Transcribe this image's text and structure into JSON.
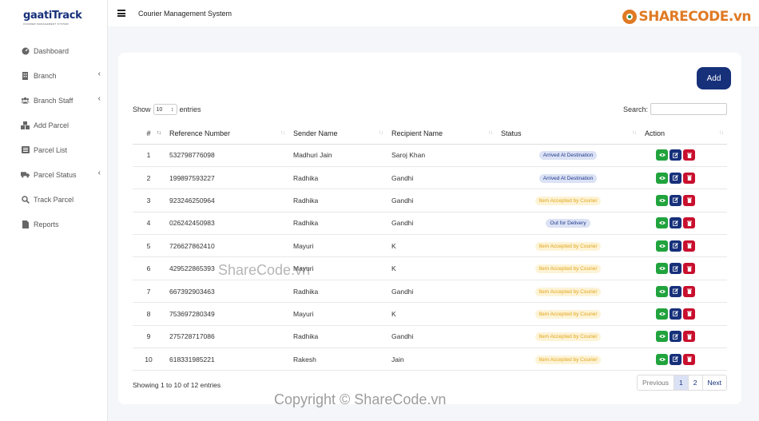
{
  "brand": {
    "name": "gaatiTrack",
    "tagline": "COURIER MANAGEMENT SYSTEM"
  },
  "app_title": "Courier Management System",
  "sidebar": {
    "items": [
      {
        "label": "Dashboard",
        "icon": "dashboard-icon",
        "submenu": false
      },
      {
        "label": "Branch",
        "icon": "building-icon",
        "submenu": true
      },
      {
        "label": "Branch Staff",
        "icon": "users-icon",
        "submenu": true
      },
      {
        "label": "Add Parcel",
        "icon": "boxes-icon",
        "submenu": false
      },
      {
        "label": "Parcel List",
        "icon": "list-icon",
        "submenu": false
      },
      {
        "label": "Parcel Status",
        "icon": "truck-icon",
        "submenu": true
      },
      {
        "label": "Track Parcel",
        "icon": "search-icon",
        "submenu": false
      },
      {
        "label": "Reports",
        "icon": "file-icon",
        "submenu": false
      }
    ]
  },
  "toolbar": {
    "add_label": "Add"
  },
  "length": {
    "show": "Show",
    "value": "10",
    "entries": "entries"
  },
  "search": {
    "label": "Search:",
    "value": ""
  },
  "table": {
    "columns": [
      "#",
      "Reference Number",
      "Sender Name",
      "Recipient Name",
      "Status",
      "Action"
    ],
    "rows": [
      {
        "no": "1",
        "ref": "532798776098",
        "sender": "Madhuri Jain",
        "recipient": "Saroj Khan",
        "status": "Arrived At Destination",
        "tone": "blue"
      },
      {
        "no": "2",
        "ref": "199897593227",
        "sender": "Radhika",
        "recipient": "Gandhi",
        "status": "Arrived At Destination",
        "tone": "blue"
      },
      {
        "no": "3",
        "ref": "923246250964",
        "sender": "Radhika",
        "recipient": "Gandhi",
        "status": "Item Accepted by Courier",
        "tone": "yellow"
      },
      {
        "no": "4",
        "ref": "026242450983",
        "sender": "Radhika",
        "recipient": "Gandhi",
        "status": "Out for Delivery",
        "tone": "blue"
      },
      {
        "no": "5",
        "ref": "726627862410",
        "sender": "Mayuri",
        "recipient": "K",
        "status": "Item Accepted by Courier",
        "tone": "yellow"
      },
      {
        "no": "6",
        "ref": "429522865393",
        "sender": "Mayuri",
        "recipient": "K",
        "status": "Item Accepted by Courier",
        "tone": "yellow"
      },
      {
        "no": "7",
        "ref": "667392903463",
        "sender": "Radhika",
        "recipient": "Gandhi",
        "status": "Item Accepted by Courier",
        "tone": "yellow"
      },
      {
        "no": "8",
        "ref": "753697280349",
        "sender": "Mayuri",
        "recipient": "K",
        "status": "Item Accepted by Courier",
        "tone": "yellow"
      },
      {
        "no": "9",
        "ref": "275728717086",
        "sender": "Radhika",
        "recipient": "Gandhi",
        "status": "Item Accepted by Courier",
        "tone": "yellow"
      },
      {
        "no": "10",
        "ref": "618331985221",
        "sender": "Rakesh",
        "recipient": "Jain",
        "status": "Item Accepted by Courier",
        "tone": "yellow"
      }
    ]
  },
  "footer": {
    "info": "Showing 1 to 10 of 12 entries",
    "pages": [
      "Previous",
      "1",
      "2",
      "Next"
    ]
  },
  "watermarks": {
    "top": "SHARECODE.vn",
    "center": "ShareCode.vn",
    "bottom": "Copyright © ShareCode.vn"
  },
  "colors": {
    "brand": "#16307a",
    "view": "#21a33d",
    "edit": "#16307a",
    "delete": "#c8102e",
    "badge_blue": "#dce2f5",
    "badge_yellow": "#fdf3d6"
  }
}
